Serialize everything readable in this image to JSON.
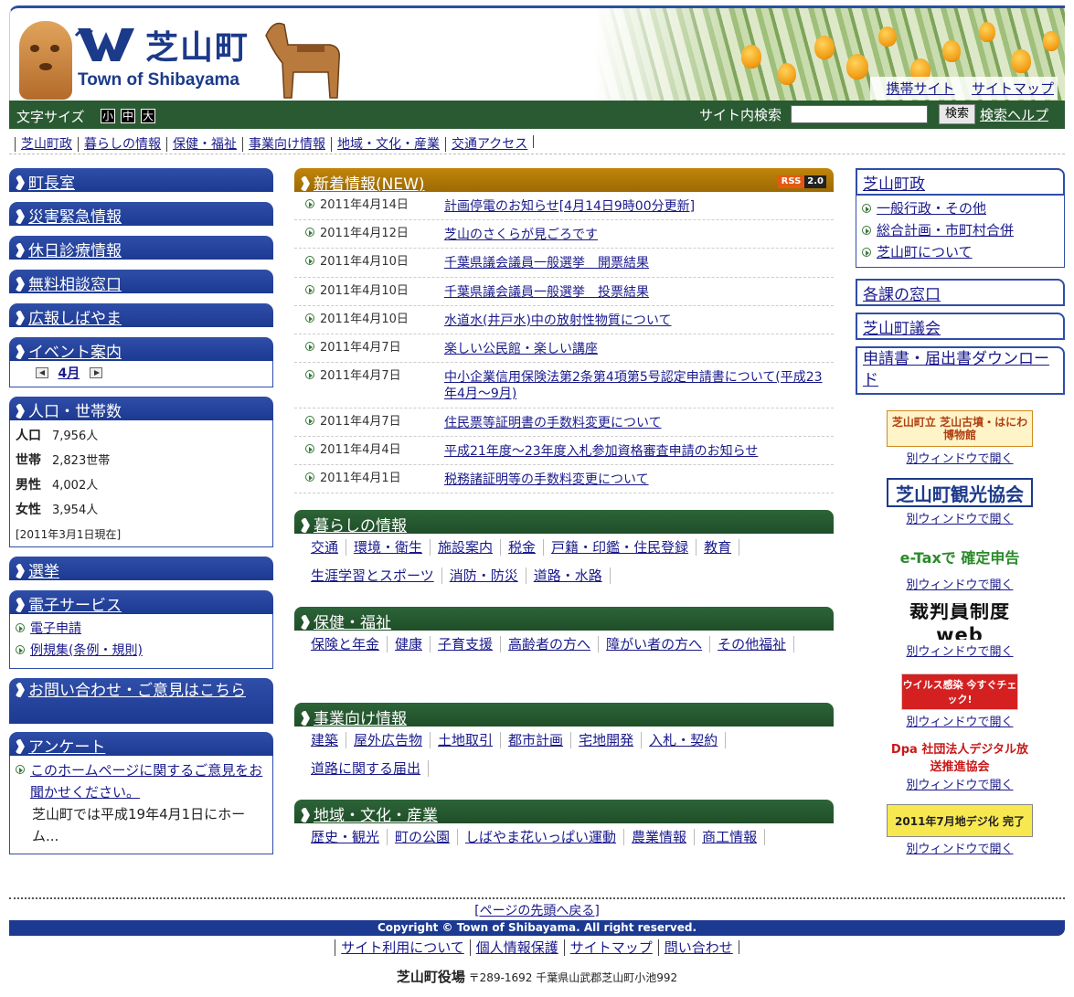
{
  "header": {
    "title": "芝山町",
    "subtitle": "Town of Shibayama",
    "links": [
      "携帯サイト",
      "サイトマップ"
    ]
  },
  "toolbar": {
    "font_size_label": "文字サイズ",
    "font_sizes": [
      "小",
      "中",
      "大"
    ],
    "search_label": "サイト内検索",
    "search_value": "",
    "search_button": "検索",
    "search_help": "検索ヘルプ"
  },
  "global_nav": [
    "芝山町政",
    "暮らしの情報",
    "保健・福祉",
    "事業向け情報",
    "地域・文化・産業",
    "交通アクセス"
  ],
  "left": {
    "mayor": "町長室",
    "disaster": "災害緊急情報",
    "holiday_clinic": "休日診療情報",
    "consult": "無料相談窓口",
    "pr": "広報しばやま",
    "events": {
      "title": "イベント案内",
      "month": "4月"
    },
    "population": {
      "title": "人口・世帯数",
      "rows": [
        {
          "label": "人口",
          "value": "7,956人"
        },
        {
          "label": "世帯",
          "value": "2,823世帯"
        },
        {
          "label": "男性",
          "value": "4,002人"
        },
        {
          "label": "女性",
          "value": "3,954人"
        }
      ],
      "as_of": "[2011年3月1日現在]"
    },
    "election": "選挙",
    "e_service": {
      "title": "電子サービス",
      "items": [
        "電子申請",
        "例規集(条例・規則)"
      ]
    },
    "contact": "お問い合わせ・ご意見はこちら",
    "survey": {
      "title": "アンケート",
      "link": "このホームページに関するご意見をお聞かせください。",
      "text": "芝山町では平成19年4月1日にホーム..."
    }
  },
  "news": {
    "title": "新着情報(NEW)",
    "rss": [
      "RSS",
      "2.0"
    ],
    "items": [
      {
        "date": "2011年4月14日",
        "title": "計画停電のお知らせ[4月14日9時00分更新]"
      },
      {
        "date": "2011年4月12日",
        "title": "芝山のさくらが見ごろです"
      },
      {
        "date": "2011年4月10日",
        "title": "千葉県議会議員一般選挙　開票結果"
      },
      {
        "date": "2011年4月10日",
        "title": "千葉県議会議員一般選挙　投票結果"
      },
      {
        "date": "2011年4月10日",
        "title": "水道水(井戸水)中の放射性物質について"
      },
      {
        "date": "2011年4月7日",
        "title": "楽しい公民館・楽しい講座"
      },
      {
        "date": "2011年4月7日",
        "title": "中小企業信用保険法第2条第4項第5号認定申請書について(平成23年4月～9月)"
      },
      {
        "date": "2011年4月7日",
        "title": "住民票等証明書の手数料変更について"
      },
      {
        "date": "2011年4月4日",
        "title": "平成21年度～23年度入札参加資格審査申請のお知らせ"
      },
      {
        "date": "2011年4月1日",
        "title": "税務諸証明等の手数料変更について"
      }
    ]
  },
  "categories": [
    {
      "title": "暮らしの情報",
      "links": [
        "交通",
        "環境・衛生",
        "施設案内",
        "税金",
        "戸籍・印鑑・住民登録",
        "教育",
        "生涯学習とスポーツ",
        "消防・防災",
        "道路・水路"
      ]
    },
    {
      "title": "保健・福祉",
      "links": [
        "保険と年金",
        "健康",
        "子育支援",
        "高齢者の方へ",
        "障がい者の方へ",
        "その他福祉"
      ]
    },
    {
      "title": "事業向け情報",
      "links": [
        "建築",
        "屋外広告物",
        "土地取引",
        "都市計画",
        "宅地開発",
        "入札・契約",
        "道路に関する届出"
      ]
    },
    {
      "title": "地域・文化・産業",
      "links": [
        "歴史・観光",
        "町の公園",
        "しばやま花いっぱい運動",
        "農業情報",
        "商工情報"
      ]
    }
  ],
  "right": {
    "politics": {
      "title": "芝山町政",
      "items": [
        "一般行政・その他",
        "総合計画・市町村合併",
        "芝山町について"
      ]
    },
    "departments": "各課の窓口",
    "assembly": "芝山町議会",
    "forms": "申請書・届出書ダウンロード",
    "banners": [
      {
        "name": "haniwa-museum",
        "text": "芝山町立 芝山古墳・はにわ博物館",
        "caption": "別ウィンドウで開く"
      },
      {
        "name": "tourism",
        "text": "芝山町観光協会",
        "caption": "別ウィンドウで開く"
      },
      {
        "name": "etax",
        "text": "e-Taxで 確定申告",
        "caption": "別ウィンドウで開く"
      },
      {
        "name": "saibanin",
        "text": "裁判員制度web",
        "caption": "別ウィンドウで開く"
      },
      {
        "name": "virus",
        "text": "ウイルス感染 今すぐチェック!",
        "caption": "別ウィンドウで開く"
      },
      {
        "name": "dpa",
        "text": "Dpa 社団法人デジタル放送推進協会",
        "caption": "別ウィンドウで開く"
      },
      {
        "name": "chideji",
        "text": "2011年7月地デジ化 完了",
        "caption": "別ウィンドウで開く"
      }
    ]
  },
  "footer": {
    "page_top": "[ページの先頭へ戻る]",
    "copyright": "Copyright © Town of Shibayama. All right reserved.",
    "links": [
      "サイト利用について",
      "個人情報保護",
      "サイトマップ",
      "問い合わせ"
    ],
    "office": "芝山町役場",
    "address": "〒289-1692 千葉県山武郡芝山町小池992"
  },
  "colors": {
    "nav_blue": "#1d3a92",
    "toolbar_green": "#2a5a32",
    "news_gold": "#b07a08"
  }
}
